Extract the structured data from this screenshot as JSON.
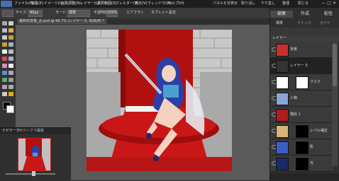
{
  "menu": [
    "ファイル(F)",
    "編集(E)",
    "イメージ(I)",
    "画質調整(N)",
    "レイヤー(L)",
    "選択範囲(S)",
    "フィルター(T)",
    "表示(V)",
    "ウィンドウ(W)",
    "ヘルプ(H)"
  ],
  "topbar": {
    "create_label": "パネルを非表示",
    "undo_label": "取り消し",
    "redo_label": "やり直し",
    "organizer_label": "整理",
    "close_label": "閉じる"
  },
  "window_controls": "—□✕",
  "options": {
    "size_label": "サイズ:",
    "size_value": "90px",
    "mode_label": "モード:",
    "mode_value": "標準",
    "opacity_label": "不透明度:",
    "opacity_value": "100%",
    "airbrush_label": "エアブラシ",
    "tablet_label": "タブレット設定"
  },
  "doc_tab": "最終的背景_合.psd @ 66.7% (レイヤー 5, RGB/8) *",
  "panel_tabs": [
    "編集",
    "作成",
    "配信"
  ],
  "panel_subtabs": [
    "標準",
    "クイック",
    "ガイド"
  ],
  "layers_header": "レイヤー",
  "layers": [
    {
      "name": "背景",
      "thumb_color": "#c9302c"
    },
    {
      "name": "レイヤー 5",
      "thumb_color": "#333333"
    },
    {
      "name": "マスク",
      "thumb_color": "#ffffff"
    },
    {
      "name": "人物",
      "thumb_color": "#8aa6d9"
    },
    {
      "name": "階段 1",
      "thumb_color": "#b01c1c"
    },
    {
      "name": "レベル補正",
      "thumb_color": "#202020"
    },
    {
      "name": "影",
      "thumb_color": "#111111"
    },
    {
      "name": "光",
      "thumb_color": "#1a2a6b"
    }
  ],
  "nav_tabs": [
    "ナビゲーター",
    "ヒストグラム",
    "情報"
  ],
  "colors": {
    "carpet": "#c91717",
    "carpet_dark": "#7b0000",
    "stone": "#bdbdbd",
    "accent": "#4a6fb5"
  }
}
